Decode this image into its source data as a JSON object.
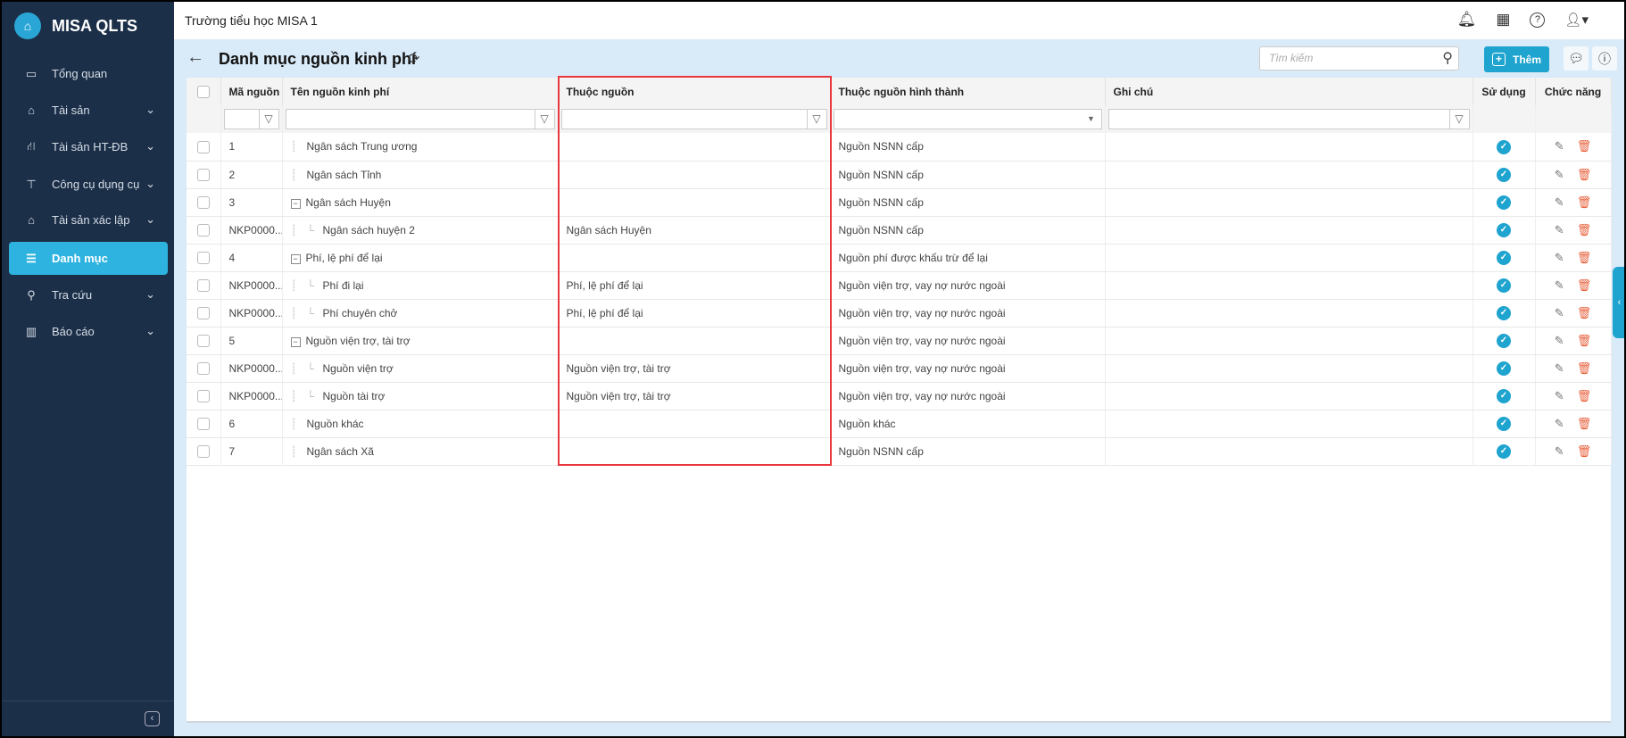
{
  "app": {
    "name": "MISA QLTS",
    "school": "Trường tiểu học MISA 1"
  },
  "sidebar": {
    "items": [
      {
        "label": "Tổng quan",
        "icon": "dashboard-icon",
        "chevron": false
      },
      {
        "label": "Tài sản",
        "icon": "house-car-icon",
        "chevron": true
      },
      {
        "label": "Tài sản HT-ĐB",
        "icon": "road-icon",
        "chevron": true
      },
      {
        "label": "Công cụ dụng cụ",
        "icon": "paint-roller-icon",
        "chevron": true
      },
      {
        "label": "Tài sản xác lập",
        "icon": "house-car-icon",
        "chevron": true
      },
      {
        "label": "Danh mục",
        "icon": "list-icon",
        "chevron": false,
        "active": true
      },
      {
        "label": "Tra cứu",
        "icon": "search-icon",
        "chevron": true
      },
      {
        "label": "Báo cáo",
        "icon": "report-icon",
        "chevron": true
      }
    ]
  },
  "page": {
    "title": "Danh mục nguồn kinh phí",
    "search_placeholder": "Tìm kiếm",
    "add_label": "Thêm"
  },
  "table": {
    "headers": [
      "Mã nguồn",
      "Tên nguồn kinh phí",
      "Thuộc nguồn",
      "Thuộc nguồn hình thành",
      "Ghi chú",
      "Sử dụng",
      "Chức năng"
    ],
    "rows": [
      {
        "code": "1",
        "name": "Ngân sách Trung ương",
        "level": 0,
        "expand": false,
        "parent": "",
        "formation": "Nguồn NSNN cấp",
        "note": ""
      },
      {
        "code": "2",
        "name": "Ngân sách Tỉnh",
        "level": 0,
        "expand": false,
        "parent": "",
        "formation": "Nguồn NSNN cấp",
        "note": ""
      },
      {
        "code": "3",
        "name": "Ngân sách Huyện",
        "level": 0,
        "expand": true,
        "parent": "",
        "formation": "Nguồn NSNN cấp",
        "note": ""
      },
      {
        "code": "NKP0000...",
        "name": "Ngân sách huyện 2",
        "level": 1,
        "expand": false,
        "parent": "Ngân sách Huyện",
        "formation": "Nguồn NSNN cấp",
        "note": ""
      },
      {
        "code": "4",
        "name": "Phí, lệ phí để lại",
        "level": 0,
        "expand": true,
        "parent": "",
        "formation": "Nguồn phí được khấu trừ để lại",
        "note": ""
      },
      {
        "code": "NKP0000...",
        "name": "Phí đi lại",
        "level": 1,
        "expand": false,
        "parent": "Phí, lệ phí để lại",
        "formation": "Nguồn viện trợ, vay nợ nước ngoài",
        "note": ""
      },
      {
        "code": "NKP0000...",
        "name": "Phí chuyên chở",
        "level": 1,
        "expand": false,
        "parent": "Phí, lệ phí để lại",
        "formation": "Nguồn viện trợ, vay nợ nước ngoài",
        "note": ""
      },
      {
        "code": "5",
        "name": "Nguồn viện trợ, tài trợ",
        "level": 0,
        "expand": true,
        "parent": "",
        "formation": "Nguồn viện trợ, vay nợ nước ngoài",
        "note": ""
      },
      {
        "code": "NKP0000...",
        "name": "Nguồn viện trợ",
        "level": 1,
        "expand": false,
        "parent": "Nguồn viện trợ, tài trợ",
        "formation": "Nguồn viện trợ, vay nợ nước ngoài",
        "note": ""
      },
      {
        "code": "NKP0000...",
        "name": "Nguồn tài trợ",
        "level": 1,
        "expand": false,
        "parent": "Nguồn viện trợ, tài trợ",
        "formation": "Nguồn viện trợ, vay nợ nước ngoài",
        "note": ""
      },
      {
        "code": "6",
        "name": "Nguồn khác",
        "level": 0,
        "expand": false,
        "parent": "",
        "formation": "Nguồn khác",
        "note": ""
      },
      {
        "code": "7",
        "name": "Ngân sách Xã",
        "level": 0,
        "expand": false,
        "parent": "",
        "formation": "Nguồn NSNN cấp",
        "note": ""
      }
    ]
  },
  "colors": {
    "sidebar": "#1c2f48",
    "accent": "#1ea4cf",
    "active": "#2eb3e0",
    "highlight": "#e8383d",
    "delete": "#e8603c"
  }
}
